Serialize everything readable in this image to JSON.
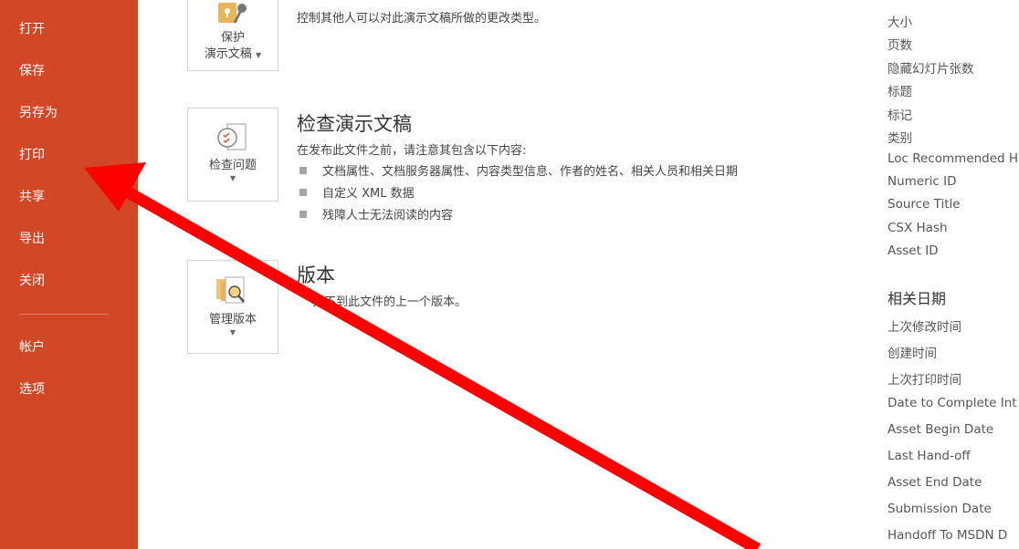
{
  "sidebar": {
    "items": [
      {
        "label": "打开"
      },
      {
        "label": "保存"
      },
      {
        "label": "另存为"
      },
      {
        "label": "打印"
      },
      {
        "label": "共享"
      },
      {
        "label": "导出"
      },
      {
        "label": "关闭"
      },
      {
        "label": "帐户"
      },
      {
        "label": "选项"
      }
    ],
    "color": "#d24726"
  },
  "protect": {
    "button_line1": "保护",
    "button_line2": "演示文稿",
    "desc": "控制其他人可以对此演示文稿所做的更改类型。"
  },
  "inspect": {
    "button": "检查问题",
    "title": "检查演示文稿",
    "desc": "在发布此文件之前，请注意其包含以下内容:",
    "bullets": [
      "文档属性、文档服务器属性、内容类型信息、作者的姓名、相关人员和相关日期",
      "自定义 XML 数据",
      "残障人士无法阅读的内容"
    ]
  },
  "versions": {
    "button": "管理版本",
    "title": "版本",
    "desc": "找不到此文件的上一个版本。"
  },
  "properties": {
    "items": [
      "大小",
      "页数",
      "隐藏幻灯片张数",
      "标题",
      "标记",
      "类别",
      "Loc Recommended H",
      "Numeric ID",
      "Source Title",
      "CSX Hash",
      "Asset ID"
    ]
  },
  "dates": {
    "title": "相关日期",
    "items": [
      "上次修改时间",
      "创建时间",
      "上次打印时间",
      "Date to Complete Int",
      "Asset Begin Date",
      "Last Hand-off",
      "Asset End Date",
      "Submission Date",
      "Handoff To MSDN D"
    ]
  },
  "annotation": {
    "arrow_color": "#ff0000"
  }
}
